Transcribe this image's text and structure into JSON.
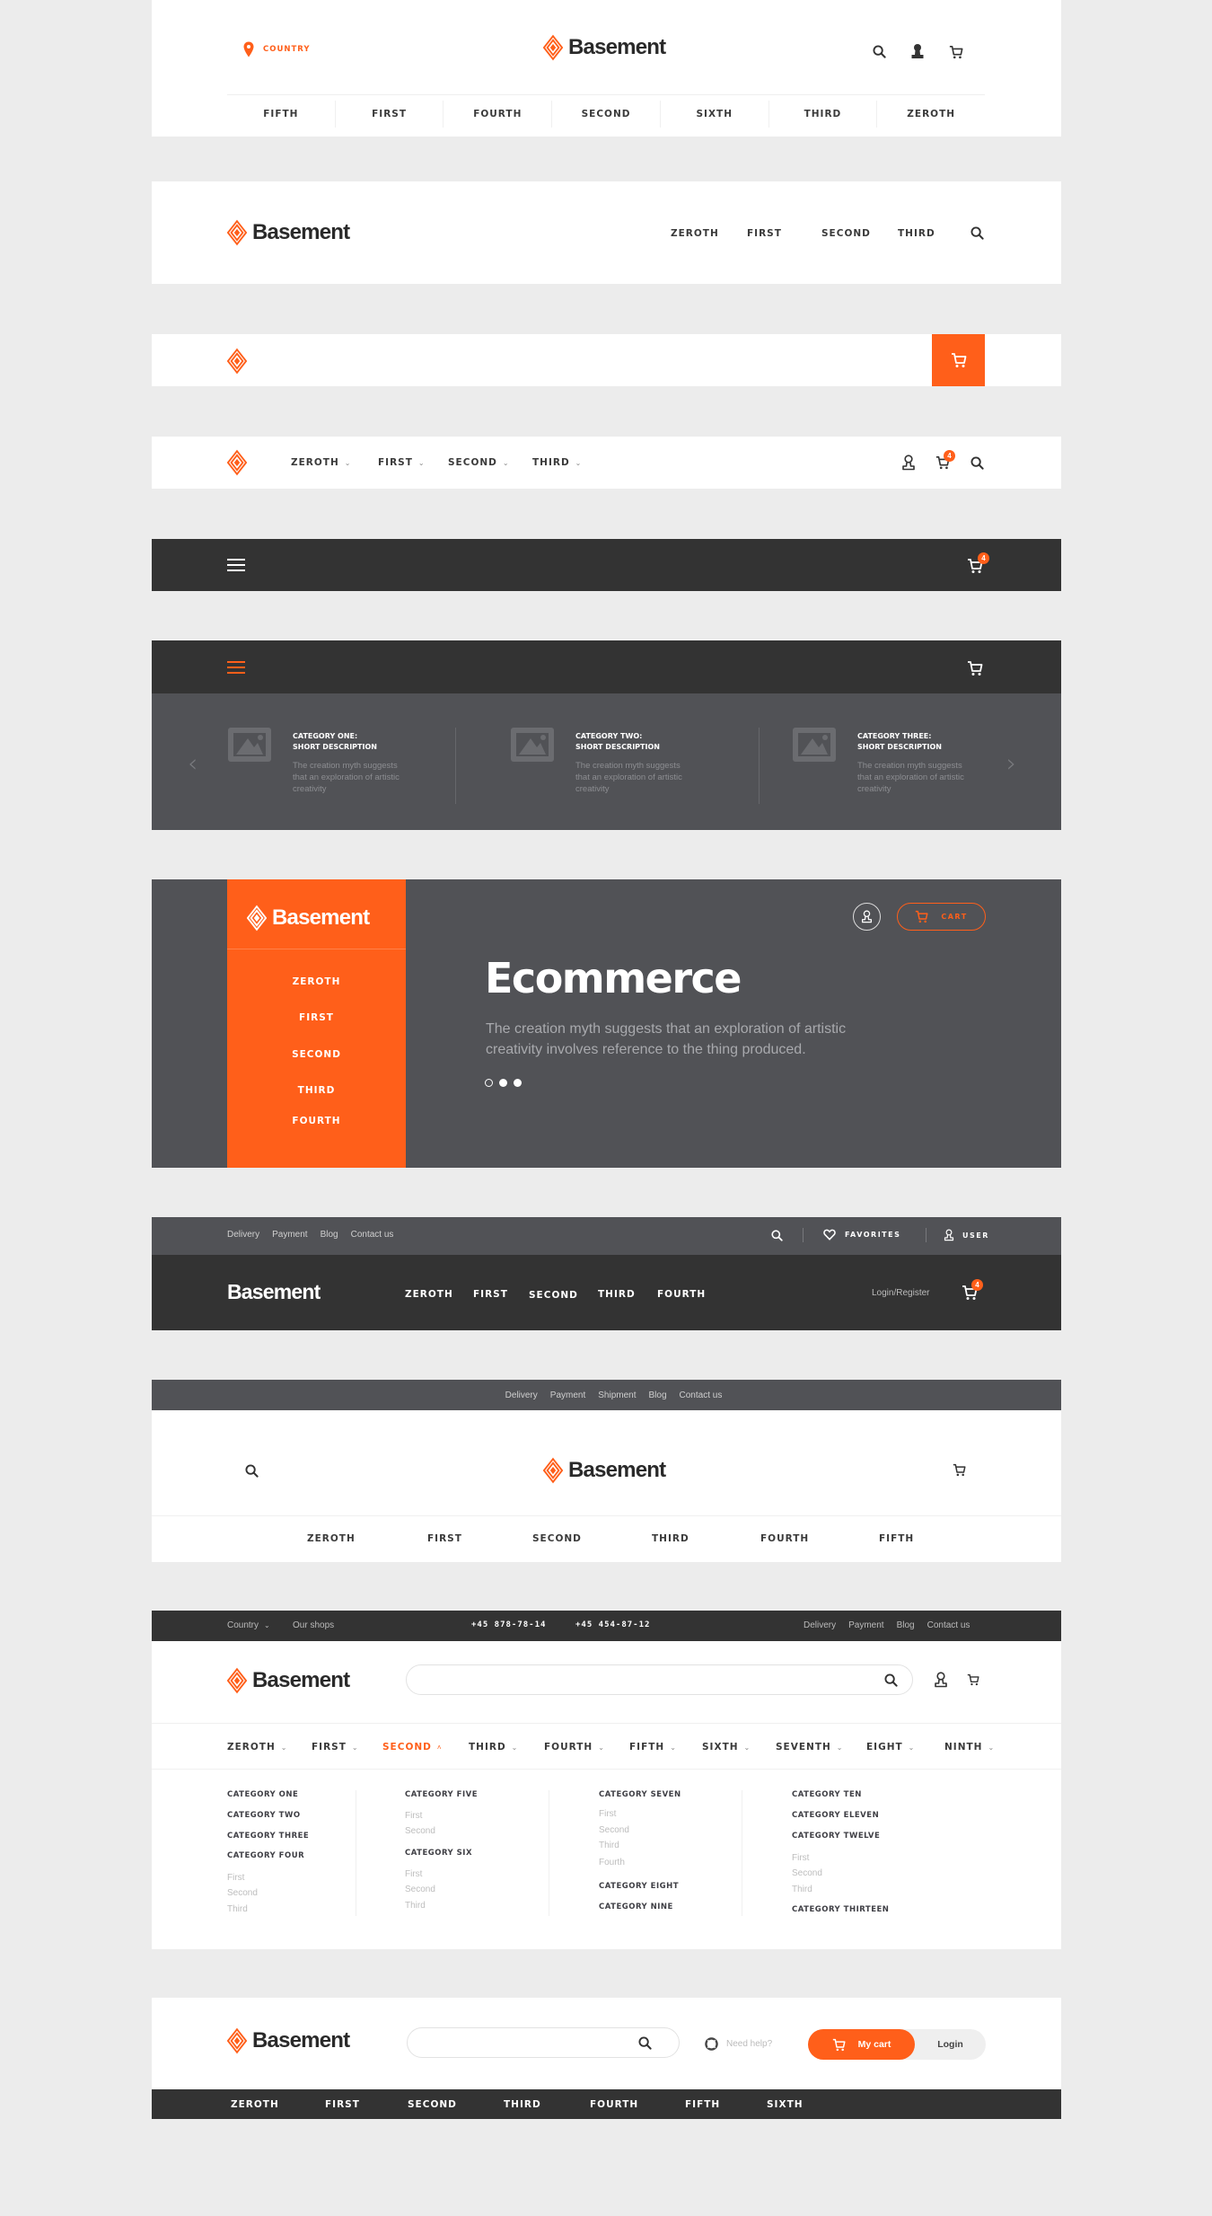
{
  "brand": {
    "name": "Basement",
    "accent_color": "#ff5f1a",
    "dark_color": "#333333",
    "gray_color": "#515256"
  },
  "header1": {
    "location_label": "COUNTRY",
    "nav": [
      "FIFTH",
      "FIRST",
      "FOURTH",
      "SECOND",
      "SIXTH",
      "THIRD",
      "ZEROTH"
    ],
    "icons": [
      "search-icon",
      "user-icon",
      "cart-icon"
    ]
  },
  "header2": {
    "nav": [
      "ZEROTH",
      "FIRST",
      "SECOND",
      "THIRD"
    ],
    "icons": [
      "search-icon"
    ]
  },
  "header3": {
    "icons": [
      "logo-mark",
      "cart-icon"
    ]
  },
  "header4": {
    "nav": [
      "ZEROTH",
      "FIRST",
      "SECOND",
      "THIRD"
    ],
    "cart_count": "4",
    "icons": [
      "user-icon",
      "cart-icon",
      "search-icon"
    ]
  },
  "header5": {
    "cart_count": "4",
    "icons": [
      "menu-icon",
      "cart-icon"
    ]
  },
  "header6": {
    "icons": [
      "menu-icon",
      "cart-icon",
      "chevron-left-icon",
      "chevron-right-icon"
    ],
    "categories": [
      {
        "title_line1": "CATEGORY ONE:",
        "title_line2": "SHORT DESCRIPTION",
        "desc": [
          "The creation myth suggests",
          "that an exploration of artistic",
          "creativity"
        ]
      },
      {
        "title_line1": "CATEGORY TWO:",
        "title_line2": "SHORT DESCRIPTION",
        "desc": [
          "The creation myth suggests",
          "that an exploration of artistic",
          "creativity"
        ]
      },
      {
        "title_line1": "CATEGORY THREE:",
        "title_line2": "SHORT DESCRIPTION",
        "desc": [
          "The creation myth suggests",
          "that an exploration of artistic",
          "creativity"
        ]
      }
    ]
  },
  "header7": {
    "side_nav": [
      "ZEROTH",
      "FIRST",
      "SECOND",
      "THIRD",
      "FOURTH"
    ],
    "cart_label": "CART",
    "hero_title": "Ecommerce",
    "hero_text_line1": "The creation myth suggests that an exploration of artistic",
    "hero_text_line2": "creativity involves reference to the thing produced.",
    "slider_dots": 3,
    "active_dot": 1
  },
  "header8": {
    "top_links": [
      "Delivery",
      "Payment",
      "Blog",
      "Contact us"
    ],
    "favorites_label": "FAVORITES",
    "user_label": "USER",
    "nav": [
      "ZEROTH",
      "FIRST",
      "SECOND",
      "THIRD",
      "FOURTH"
    ],
    "login_label": "Login/Register",
    "cart_count": "4"
  },
  "header9": {
    "top_links": [
      "Delivery",
      "Payment",
      "Shipment",
      "Blog",
      "Contact us"
    ],
    "nav": [
      "ZEROTH",
      "FIRST",
      "SECOND",
      "THIRD",
      "FOURTH",
      "FIFTH"
    ]
  },
  "header10": {
    "country_label": "Country",
    "shops_label": "Our shops",
    "phone1": "+45 878-78-14",
    "phone2": "+45 454-87-12",
    "top_links": [
      "Delivery",
      "Payment",
      "Blog",
      "Contact us"
    ],
    "search_placeholder": "",
    "nav": [
      "ZEROTH",
      "FIRST",
      "SECOND",
      "THIRD",
      "FOURTH",
      "FIFTH",
      "SIXTH",
      "SEVENTH",
      "EIGHT",
      "NINTH"
    ],
    "active_nav": "SECOND",
    "mega_menu": {
      "col1": {
        "heads": [
          "CATEGORY ONE",
          "CATEGORY TWO",
          "CATEGORY THREE",
          "CATEGORY FOUR"
        ],
        "subs": [
          "First",
          "Second",
          "Third"
        ]
      },
      "col2": {
        "head1": "CATEGORY FIVE",
        "subs1": [
          "First",
          "Second"
        ],
        "head2": "CATEGORY SIX",
        "subs2": [
          "First",
          "Second",
          "Third"
        ]
      },
      "col3": {
        "head1": "CATEGORY SEVEN",
        "subs1": [
          "First",
          "Second",
          "Third",
          "Fourth"
        ],
        "heads2": [
          "CATEGORY EIGHT",
          "CATEGORY NINE"
        ]
      },
      "col4": {
        "heads": [
          "CATEGORY TEN",
          "CATEGORY ELEVEN",
          "CATEGORY TWELVE"
        ],
        "subs": [
          "First",
          "Second",
          "Third"
        ],
        "head_last": "CATEGORY THIRTEEN"
      }
    }
  },
  "header11": {
    "search_placeholder": "",
    "help_label": "Need help?",
    "cart_label": "My cart",
    "login_label": "Login",
    "nav": [
      "ZEROTH",
      "FIRST",
      "SECOND",
      "THIRD",
      "FOURTH",
      "FIFTH",
      "SIXTH"
    ]
  }
}
